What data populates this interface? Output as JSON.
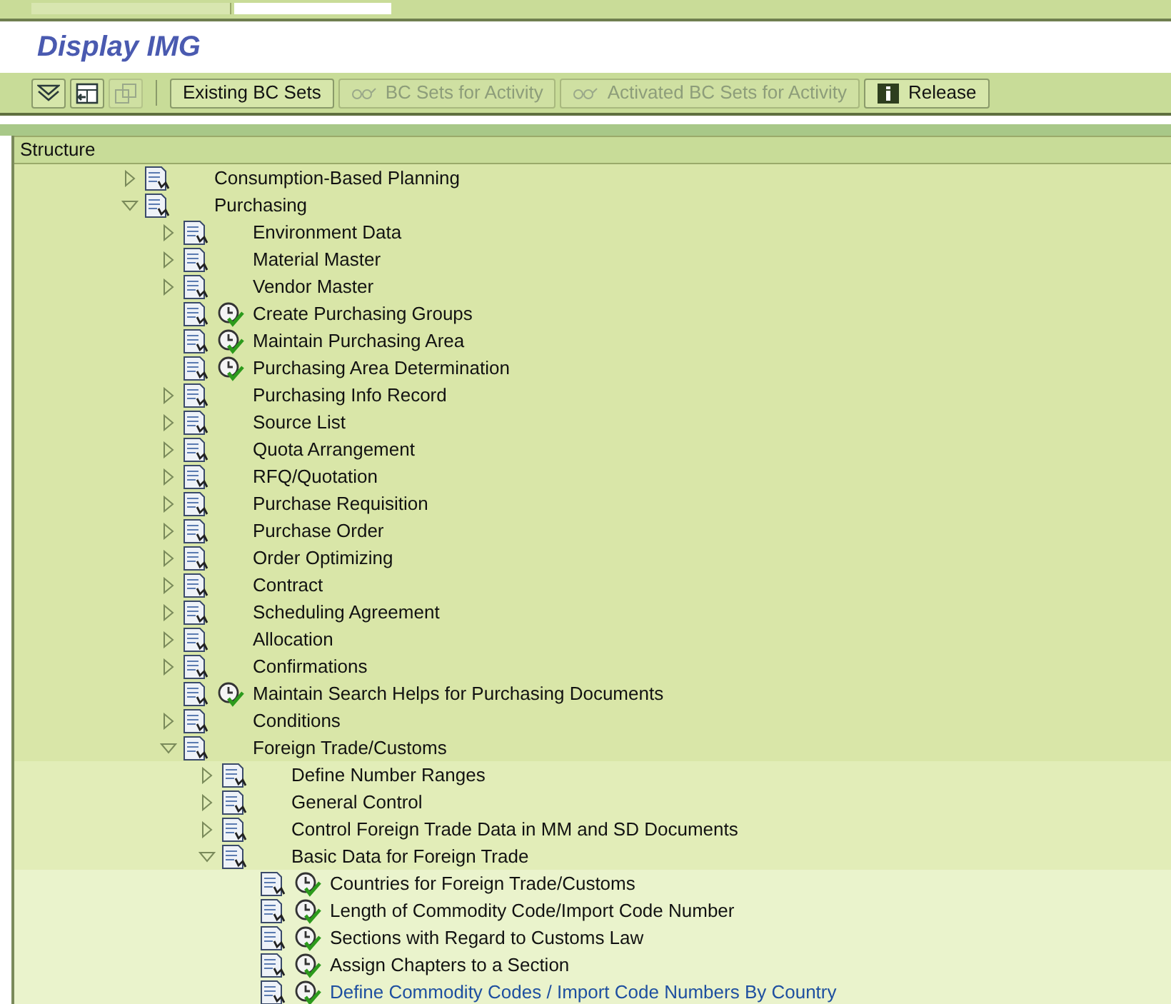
{
  "title": "Display IMG",
  "toolbar": [
    {
      "kind": "icon",
      "disabled": false
    },
    {
      "kind": "icon",
      "disabled": false
    },
    {
      "kind": "icon",
      "disabled": true
    },
    {
      "kind": "separator"
    },
    {
      "kind": "text",
      "label": "Existing BC Sets",
      "disabled": false
    },
    {
      "kind": "text",
      "label": "BC Sets for Activity",
      "disabled": true
    },
    {
      "kind": "text",
      "label": "Activated BC Sets for Activity",
      "disabled": true
    },
    {
      "kind": "text",
      "label": "Release",
      "disabled": false
    }
  ],
  "tree": {
    "header": "Structure",
    "nodes": [
      {
        "kind": "folder",
        "label": "Consumption-Based Planning",
        "expanded": false,
        "selected": false
      },
      {
        "kind": "folder",
        "label": "Purchasing",
        "expanded": true,
        "selected": false,
        "children": [
          {
            "kind": "folder",
            "label": "Environment Data",
            "expanded": false,
            "selected": false
          },
          {
            "kind": "folder",
            "label": "Material Master",
            "expanded": false,
            "selected": false
          },
          {
            "kind": "folder",
            "label": "Vendor Master",
            "expanded": false,
            "selected": false
          },
          {
            "kind": "activity",
            "label": "Create Purchasing Groups",
            "selected": false
          },
          {
            "kind": "activity",
            "label": "Maintain Purchasing Area",
            "selected": false
          },
          {
            "kind": "activity",
            "label": "Purchasing Area Determination",
            "selected": false
          },
          {
            "kind": "folder",
            "label": "Purchasing Info Record",
            "expanded": false,
            "selected": false
          },
          {
            "kind": "folder",
            "label": "Source List",
            "expanded": false,
            "selected": false
          },
          {
            "kind": "folder",
            "label": "Quota Arrangement",
            "expanded": false,
            "selected": false
          },
          {
            "kind": "folder",
            "label": "RFQ/Quotation",
            "expanded": false,
            "selected": false
          },
          {
            "kind": "folder",
            "label": "Purchase Requisition",
            "expanded": false,
            "selected": false
          },
          {
            "kind": "folder",
            "label": "Purchase Order",
            "expanded": false,
            "selected": false
          },
          {
            "kind": "folder",
            "label": "Order Optimizing",
            "expanded": false,
            "selected": false
          },
          {
            "kind": "folder",
            "label": "Contract",
            "expanded": false,
            "selected": false
          },
          {
            "kind": "folder",
            "label": "Scheduling Agreement",
            "expanded": false,
            "selected": false
          },
          {
            "kind": "folder",
            "label": "Allocation",
            "expanded": false,
            "selected": false
          },
          {
            "kind": "folder",
            "label": "Confirmations",
            "expanded": false,
            "selected": false
          },
          {
            "kind": "activity",
            "label": "Maintain Search Helps for Purchasing Documents",
            "selected": false
          },
          {
            "kind": "folder",
            "label": "Conditions",
            "expanded": false,
            "selected": false
          },
          {
            "kind": "folder",
            "label": "Foreign Trade/Customs",
            "expanded": true,
            "selected": false,
            "children": [
              {
                "kind": "folder",
                "label": "Define Number Ranges",
                "expanded": false,
                "selected": false
              },
              {
                "kind": "folder",
                "label": "General Control",
                "expanded": false,
                "selected": false
              },
              {
                "kind": "folder",
                "label": "Control Foreign Trade Data in MM and SD Documents",
                "expanded": false,
                "selected": false
              },
              {
                "kind": "folder",
                "label": "Basic Data for Foreign Trade",
                "expanded": true,
                "selected": false,
                "children": [
                  {
                    "kind": "activity",
                    "label": "Countries for Foreign Trade/Customs",
                    "selected": false
                  },
                  {
                    "kind": "activity",
                    "label": "Length of Commodity Code/Import Code Number",
                    "selected": false
                  },
                  {
                    "kind": "activity",
                    "label": "Sections with Regard to Customs Law",
                    "selected": false
                  },
                  {
                    "kind": "activity",
                    "label": "Assign Chapters to a Section",
                    "selected": false
                  },
                  {
                    "kind": "activity",
                    "label": "Define Commodity Codes / Import Code Numbers By Country",
                    "selected": true
                  }
                ]
              }
            ]
          }
        ]
      }
    ]
  }
}
